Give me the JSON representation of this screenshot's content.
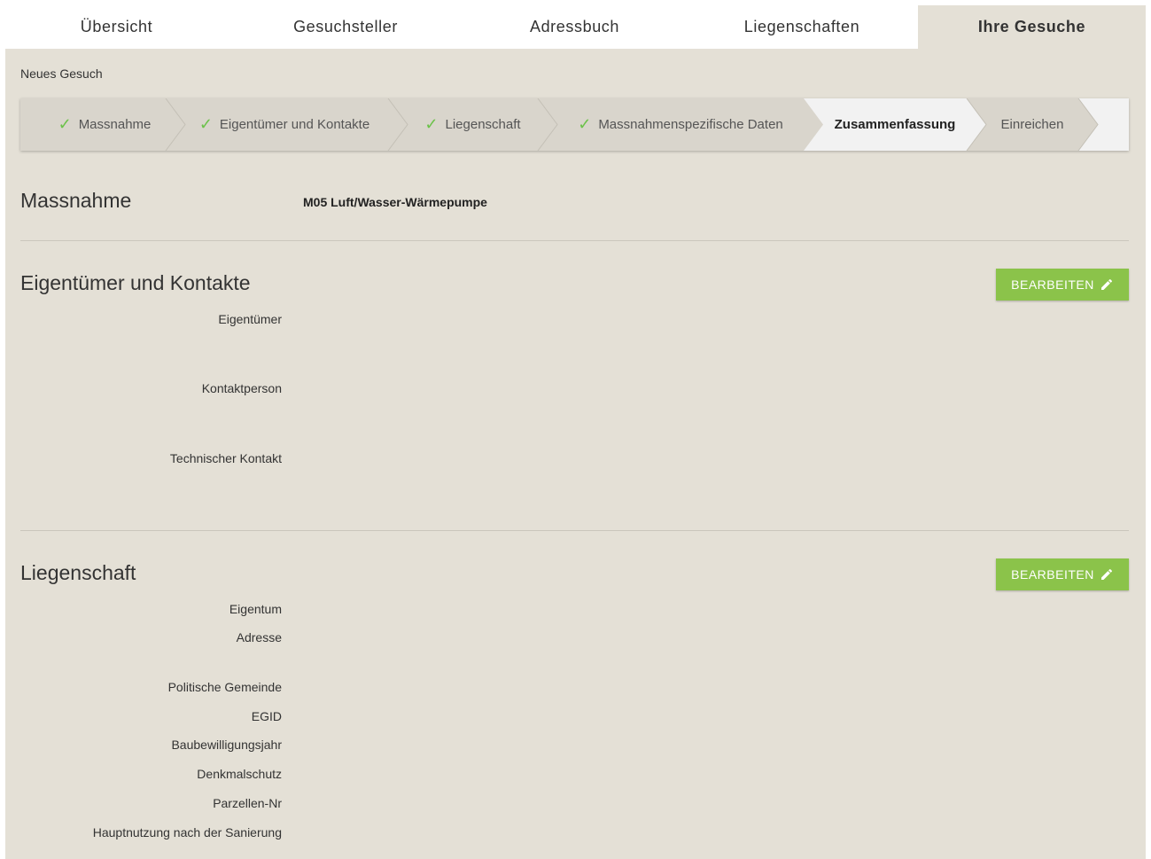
{
  "nav": {
    "tabs": [
      {
        "label": "Übersicht"
      },
      {
        "label": "Gesuchsteller"
      },
      {
        "label": "Adressbuch"
      },
      {
        "label": "Liegenschaften"
      },
      {
        "label": "Ihre Gesuche"
      }
    ],
    "active_tab": "Ihre Gesuche"
  },
  "breadcrumb": "Neues Gesuch",
  "stepper": {
    "steps": [
      {
        "label": "Massnahme",
        "done": true
      },
      {
        "label": "Eigentümer und Kontakte",
        "done": true
      },
      {
        "label": "Liegenschaft",
        "done": true
      },
      {
        "label": "Massnahmenspezifische Daten",
        "done": true
      },
      {
        "label": "Zusammenfassung",
        "done": false
      },
      {
        "label": "Einreichen",
        "done": false
      }
    ],
    "check_icon": "✓",
    "active_step": "Zusammenfassung"
  },
  "massnahme": {
    "title": "Massnahme",
    "value": "M05 Luft/Wasser-Wärmepumpe"
  },
  "eigentuemer": {
    "title": "Eigentümer und Kontakte",
    "edit_label": "BEARBEITEN",
    "labels": [
      "Eigentümer",
      "Kontaktperson",
      "Technischer Kontakt"
    ]
  },
  "liegenschaft": {
    "title": "Liegenschaft",
    "edit_label": "BEARBEITEN",
    "labels": [
      "Eigentum",
      "Adresse",
      "Politische Gemeinde",
      "EGID",
      "Baubewilligungsjahr",
      "Denkmalschutz",
      "Parzellen-Nr",
      "Hauptnutzung nach der Sanierung"
    ]
  },
  "colors": {
    "background": "#e4e0d6",
    "button": "#8bc34a",
    "check": "#6cc24a",
    "active_step": "#f2f2f2"
  }
}
